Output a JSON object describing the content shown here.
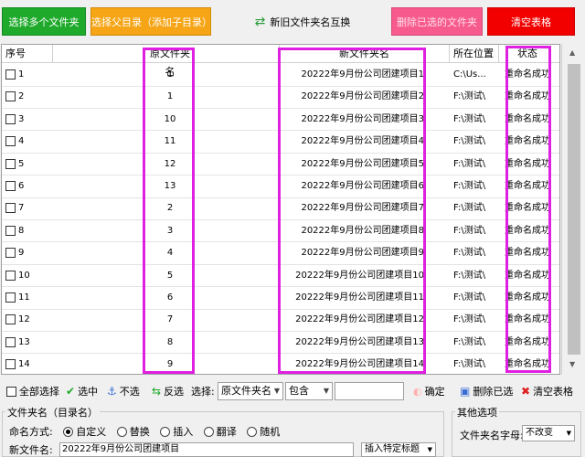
{
  "toolbar": {
    "select_files": "选择多个文件夹",
    "select_parent": "选择父目录（添加子目录）",
    "swap_names": "新旧文件夹名互换",
    "delete_selected": "删除已选的文件夹",
    "clear_table": "清空表格",
    "colors": {
      "green": "#1faa2c",
      "orange": "#f5a516",
      "pink": "#f75a8d",
      "red": "#f20000"
    }
  },
  "table": {
    "headers": {
      "seq": "序号",
      "old_name": "原文件夹名",
      "new_name": "新文件夹名",
      "location": "所在位置",
      "status": "状态"
    },
    "rows": [
      {
        "seq": "1",
        "old": "1",
        "new": "20222年9月份公司团建项目1",
        "loc": "C:\\Us...",
        "status": "重命名成功"
      },
      {
        "seq": "2",
        "old": "1",
        "new": "20222年9月份公司团建项目2",
        "loc": "F:\\测试\\",
        "status": "重命名成功"
      },
      {
        "seq": "3",
        "old": "10",
        "new": "20222年9月份公司团建项目3",
        "loc": "F:\\测试\\",
        "status": "重命名成功"
      },
      {
        "seq": "4",
        "old": "11",
        "new": "20222年9月份公司团建项目4",
        "loc": "F:\\测试\\",
        "status": "重命名成功"
      },
      {
        "seq": "5",
        "old": "12",
        "new": "20222年9月份公司团建项目5",
        "loc": "F:\\测试\\",
        "status": "重命名成功"
      },
      {
        "seq": "6",
        "old": "13",
        "new": "20222年9月份公司团建项目6",
        "loc": "F:\\测试\\",
        "status": "重命名成功"
      },
      {
        "seq": "7",
        "old": "2",
        "new": "20222年9月份公司团建项目7",
        "loc": "F:\\测试\\",
        "status": "重命名成功"
      },
      {
        "seq": "8",
        "old": "3",
        "new": "20222年9月份公司团建项目8",
        "loc": "F:\\测试\\",
        "status": "重命名成功"
      },
      {
        "seq": "9",
        "old": "4",
        "new": "20222年9月份公司团建项目9",
        "loc": "F:\\测试\\",
        "status": "重命名成功"
      },
      {
        "seq": "10",
        "old": "5",
        "new": "20222年9月份公司团建项目10",
        "loc": "F:\\测试\\",
        "status": "重命名成功"
      },
      {
        "seq": "11",
        "old": "6",
        "new": "20222年9月份公司团建项目11",
        "loc": "F:\\测试\\",
        "status": "重命名成功"
      },
      {
        "seq": "12",
        "old": "7",
        "new": "20222年9月份公司团建项目12",
        "loc": "F:\\测试\\",
        "status": "重命名成功"
      },
      {
        "seq": "13",
        "old": "8",
        "new": "20222年9月份公司团建项目13",
        "loc": "F:\\测试\\",
        "status": "重命名成功"
      },
      {
        "seq": "14",
        "old": "9",
        "new": "20222年9月份公司团建项目14",
        "loc": "F:\\测试\\",
        "status": "重命名成功"
      }
    ],
    "highlight_color": "#e020e0"
  },
  "selection": {
    "select_all": "全部选择",
    "select": "选中",
    "deselect": "不选",
    "invert": "反选",
    "choose_label": "选择:",
    "field_value": "原文件夹名",
    "match_value": "包含",
    "keyword_value": "",
    "confirm": "确定",
    "delete_selected": "删除已选",
    "clear_table": "清空表格"
  },
  "rename_panel": {
    "title": "文件夹名（目录名）",
    "mode_label": "命名方式:",
    "modes": [
      "自定义",
      "替换",
      "插入",
      "翻译",
      "随机"
    ],
    "new_name_label": "新文件名:",
    "new_name_value": "20222年9月份公司团建项目",
    "insert_button": "插入特定标题"
  },
  "other_panel": {
    "title": "其他选项",
    "case_label": "文件夹名字母:",
    "case_value": "不改变"
  }
}
